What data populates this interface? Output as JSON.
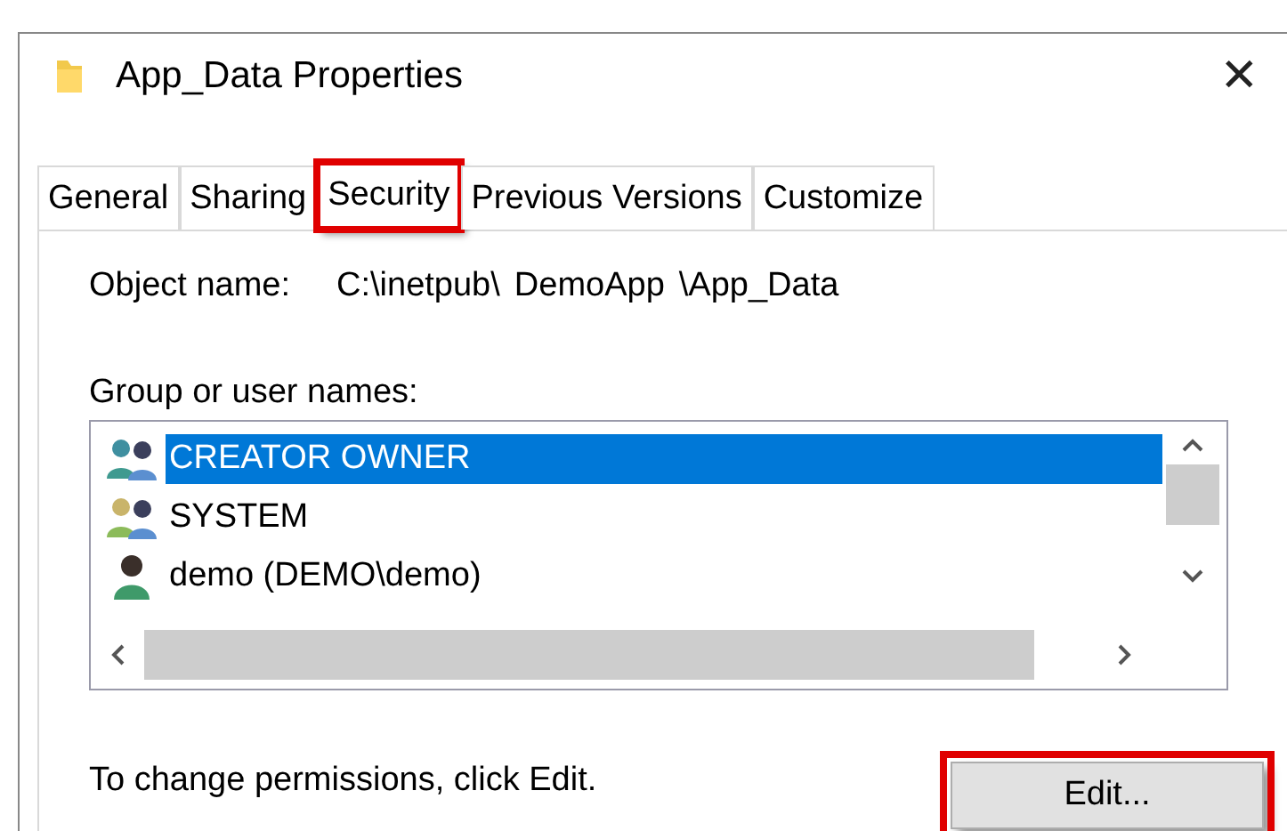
{
  "window": {
    "title": "App_Data Properties",
    "close": "✕"
  },
  "tabs": [
    {
      "label": "General",
      "selected": false,
      "highlighted": false
    },
    {
      "label": "Sharing",
      "selected": false,
      "highlighted": false
    },
    {
      "label": "Security",
      "selected": true,
      "highlighted": true
    },
    {
      "label": "Previous Versions",
      "selected": false,
      "highlighted": false
    },
    {
      "label": "Customize",
      "selected": false,
      "highlighted": false
    }
  ],
  "object_name": {
    "label": "Object name:",
    "value_parts": [
      "C:\\inetpub\\",
      "DemoApp",
      "\\App_Data"
    ]
  },
  "group_list": {
    "label": "Group or user names:",
    "items": [
      {
        "name": "CREATOR OWNER",
        "kind": "group",
        "selected": true
      },
      {
        "name": "SYSTEM",
        "kind": "group",
        "selected": false
      },
      {
        "name": "demo (DEMO\\demo)",
        "kind": "user",
        "selected": false
      }
    ]
  },
  "hint": "To change permissions, click Edit.",
  "edit_button": {
    "label": "Edit...",
    "highlighted": true
  }
}
